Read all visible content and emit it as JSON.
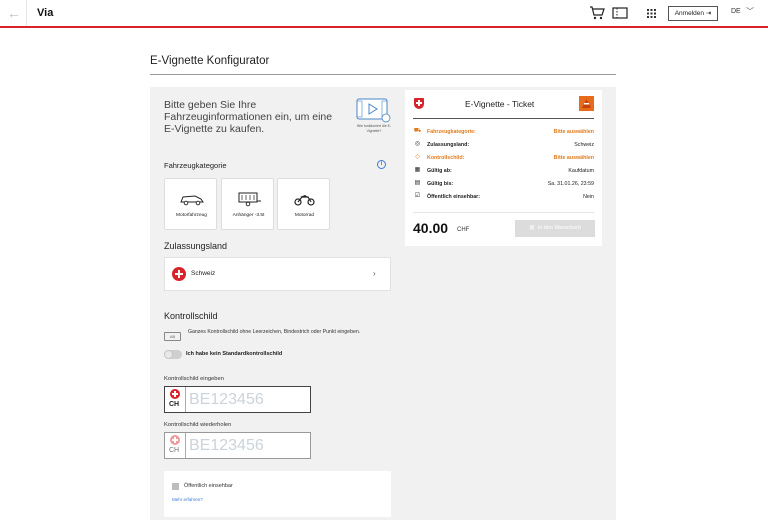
{
  "header": {
    "brand": "Via",
    "login_label": "Anmelden",
    "language": "DE",
    "accent_color": "#d8232a"
  },
  "page": {
    "title": "E-Vignette Konfigurator"
  },
  "intro": {
    "text": "Bitte geben Sie Ihre Fahrzeuginformationen ein, um eine E-Vignette zu kaufen.",
    "video_caption": "Wie funktioniert die E-Vignette?"
  },
  "vehicle": {
    "section_label": "Fahrzeugkategorie",
    "categories": [
      {
        "label": "Motorfahrzeug",
        "icon": "car-icon"
      },
      {
        "label": "Anhänger -3.5t",
        "icon": "trailer-icon"
      },
      {
        "label": "Motorrad",
        "icon": "motorcycle-icon"
      }
    ]
  },
  "country": {
    "section_label": "Zulassungsland",
    "value": "Schweiz"
  },
  "plate": {
    "section_label": "Kontrollschild",
    "hint_icon": "AB",
    "hint": "Ganzes Kontrollschild ohne Leerzeichen, Bindestrich oder Punkt eingeben.",
    "toggle_label": "Ich habe kein Standardkontrollschild",
    "input1_label": "Kontrollschild eingeben",
    "input2_label": "Kontrollschild wiederholen",
    "country_code": "CH",
    "placeholder": "BE123456"
  },
  "public": {
    "label": "Öffentlich einsehbar",
    "link": "Mehr erfahren?"
  },
  "ticket": {
    "title": "E-Vignette - Ticket",
    "rows": [
      {
        "key": "Fahrzeugkategorie:",
        "value": "Bitte auswählen",
        "icon": "car-outline-icon",
        "highlight": true
      },
      {
        "key": "Zulassungsland:",
        "value": "Schweiz",
        "icon": "location-icon",
        "highlight": false
      },
      {
        "key": "Kontrollschild:",
        "value": "Bitte auswählen",
        "icon": "tag-icon",
        "highlight": true
      },
      {
        "key": "Gültig ab:",
        "value": "Kaufdatum",
        "icon": "calendar-icon",
        "highlight": false
      },
      {
        "key": "Gültig bis:",
        "value": "Sa. 31.01.26, 23:59",
        "icon": "calendar-end-icon",
        "highlight": false
      },
      {
        "key": "Öffentlich einsehbar:",
        "value": "Nein",
        "icon": "checkbox-icon",
        "highlight": false
      }
    ],
    "price": "40.00",
    "currency": "CHF",
    "cart_button": "In den Warenkorb",
    "highlight_color": "#e27a1c"
  }
}
